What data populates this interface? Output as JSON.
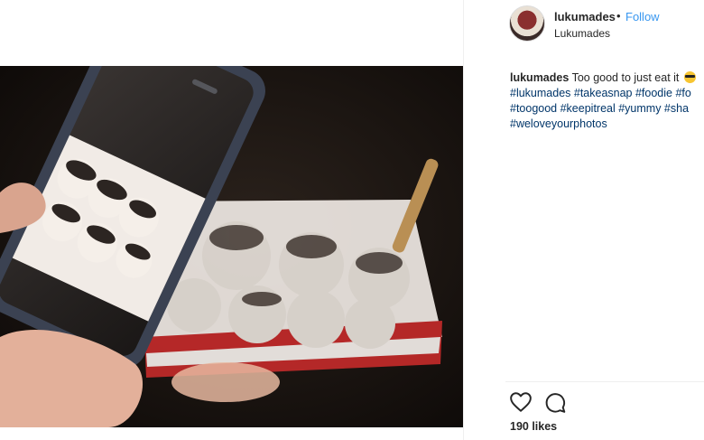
{
  "post": {
    "username": "lukumades",
    "separator": "•",
    "follow_label": "Follow",
    "location": "Lukumades",
    "caption": {
      "username": "lukumades",
      "text": "Too good to just eat it",
      "lines": [
        "#lukumades #takeasnap #foodie #fo",
        "#toogood #keepitreal #yummy #sha",
        "#weloveyourphotos"
      ]
    },
    "likes_text": "190 likes"
  },
  "icons": {
    "avatar": "profile-avatar",
    "emoji": "sunglasses-emoji-icon",
    "like": "heart-icon",
    "comment": "comment-icon"
  },
  "colors": {
    "accent": "#3897f0",
    "hashtag": "#003569",
    "text": "#262626"
  }
}
